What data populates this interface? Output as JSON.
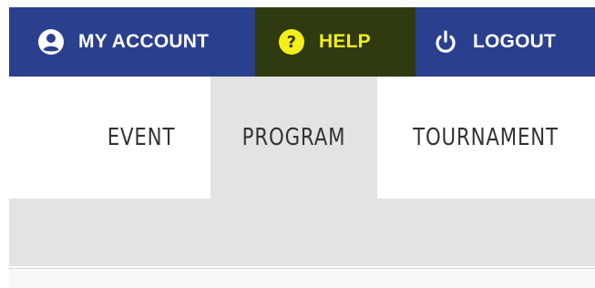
{
  "topbar": {
    "items": [
      {
        "label": "MY ACCOUNT",
        "icon": "account-circle-icon"
      },
      {
        "label": "HELP",
        "icon": "help-circle-icon"
      },
      {
        "label": "LOGOUT",
        "icon": "power-icon"
      }
    ]
  },
  "tabs": [
    {
      "label": "EVENT",
      "active": false
    },
    {
      "label": "PROGRAM",
      "active": true
    },
    {
      "label": "TOURNAMENT",
      "active": false
    }
  ],
  "colors": {
    "topbar_bg": "#2b3f8f",
    "help_highlight_bg": "#2f3a10",
    "help_text": "#f3ee1c",
    "highlight_marker": "#f3f021",
    "active_tab_bg": "#e3e3e3",
    "tab_text": "#333333"
  }
}
